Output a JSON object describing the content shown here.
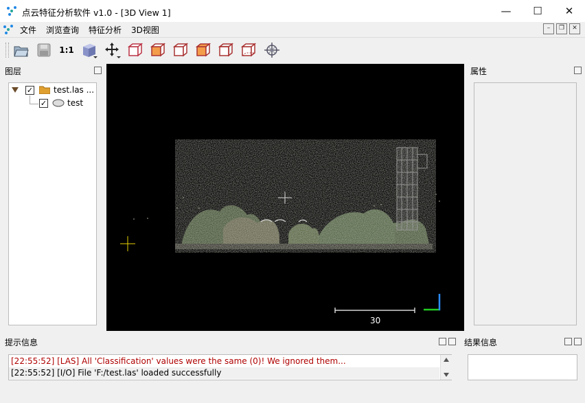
{
  "window": {
    "title": "点云特征分析软件 v1.0 - [3D View 1]",
    "controls": {
      "minimize": "—",
      "maximize": "☐",
      "close": "✕"
    }
  },
  "menu": {
    "items": [
      "文件",
      "浏览查询",
      "特征分析",
      "3D视图"
    ]
  },
  "toolbar": {
    "scale_label": "1:1",
    "icons": [
      "open-folder-icon",
      "save-icon",
      "scale-1-1",
      "view-cube-icon",
      "move-icon",
      "front-view-icon",
      "top-view-icon",
      "left-view-icon",
      "right-view-icon",
      "back-view-icon",
      "bottom-view-icon",
      "rotate-center-icon"
    ]
  },
  "layers": {
    "title": "图层",
    "tree": [
      {
        "label": "test.las ...",
        "checked": true,
        "icon": "folder-icon"
      },
      {
        "label": "test",
        "checked": true,
        "icon": "cloud-icon"
      }
    ]
  },
  "properties": {
    "title": "属性"
  },
  "viewport": {
    "scale_value": "30",
    "colors": {
      "background": "#000000",
      "axis_x": "#22cc22",
      "axis_y": "#2a8cff",
      "cursor": "#e8d200"
    }
  },
  "console": {
    "title": "提示信息",
    "lines": [
      {
        "text": "[22:55:52] [LAS] All 'Classification' values were the same (0)! We ignored them...",
        "color": "#b00000"
      },
      {
        "text": "[22:55:52] [I/O] File 'F:/test.las' loaded successfully",
        "color": "#000000"
      }
    ]
  },
  "results": {
    "title": "结果信息"
  }
}
